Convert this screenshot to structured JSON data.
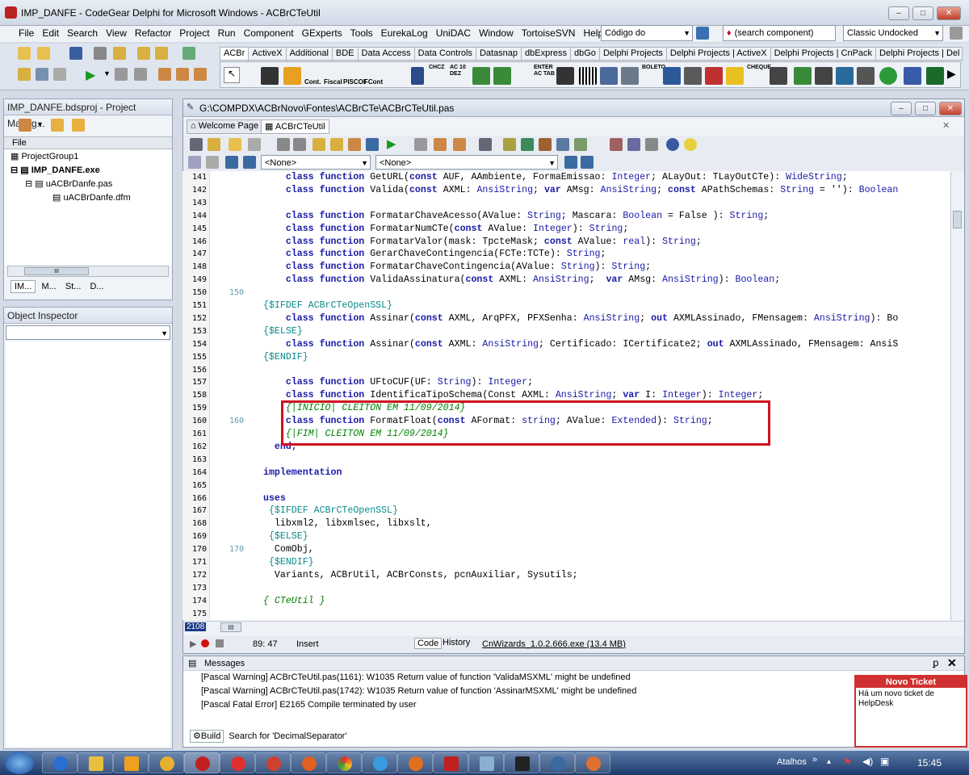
{
  "window": {
    "title": "IMP_DANFE - CodeGear Delphi for Microsoft Windows - ACBrCTeUtil",
    "min": "–",
    "max": "□",
    "close": "✕"
  },
  "menu": [
    "File",
    "Edit",
    "Search",
    "View",
    "Refactor",
    "Project",
    "Run",
    "Component",
    "GExperts",
    "Tools",
    "EurekaLog",
    "UniDAC",
    "Window",
    "TortoiseSVN",
    "Help"
  ],
  "toolbar": {
    "code_combo": "Código do",
    "search_component": "(search component)",
    "layout": "Classic Undocked"
  },
  "palette_tabs": [
    "ACBr",
    "ActiveX",
    "Additional",
    "BDE",
    "Data Access",
    "Data Controls",
    "Datasnap",
    "dbExpress",
    "dbGo",
    "Delphi Projects",
    "Delphi Projects | ActiveX",
    "Delphi Projects | CnPack",
    "Delphi Projects | Del"
  ],
  "palette_labels": [
    "Cont.",
    "Fiscal",
    "PISCOF",
    "FCont",
    "CHCZ",
    "AC 10 DEZ",
    "ENTER AC TAB",
    "BOLETO",
    "CHEQUE"
  ],
  "project_manager": {
    "title": "IMP_DANFE.bdsproj - Project Manag...",
    "file_label": "File",
    "items": [
      "ProjectGroup1",
      "IMP_DANFE.exe",
      "uACBrDanfe.pas",
      "uACBrDanfe.dfm"
    ],
    "tabs": [
      "IM...",
      "M...",
      "St...",
      "D..."
    ],
    "scroll_thumb": "III"
  },
  "object_inspector": {
    "title": "Object Inspector"
  },
  "editor": {
    "path": "G:\\COMPDX\\ACBrNovo\\Fontes\\ACBrCTe\\ACBrCTeUtil.pas",
    "tabs": [
      "Welcome Page",
      "ACBrCTeUtil"
    ],
    "combo1": "<None>",
    "combo2": "<None>",
    "status": {
      "pos": "89: 47",
      "mode": "Insert",
      "tab_code": "Code",
      "tab_history": "History",
      "wizard": "CnWizards_1.0.2.666.exe (13.4 MB)"
    },
    "hscroll": "2108",
    "hscroll_thumb": "III",
    "gutter_marks": {
      "150": "150",
      "160": "160",
      "170": "170"
    },
    "lines": [
      {
        "n": "141",
        "text": "    class function GetURL(const AUF, AAmbiente, FormaEmissao: Integer; ALayOut: TLayOutCTe): WideString;"
      },
      {
        "n": "142",
        "text": "    class function Valida(const AXML: AnsiString; var AMsg: AnsiString; const APathSchemas: String = ''): Boolean"
      },
      {
        "n": "143",
        "text": ""
      },
      {
        "n": "144",
        "text": "    class function FormatarChaveAcesso(AValue: String; Mascara: Boolean = False ): String;"
      },
      {
        "n": "145",
        "text": "    class function FormatarNumCTe(const AValue: Integer): String;"
      },
      {
        "n": "146",
        "text": "    class function FormatarValor(mask: TpcteMask; const AValue: real): String;"
      },
      {
        "n": "147",
        "text": "    class function GerarChaveContingencia(FCTe:TCTe): String;"
      },
      {
        "n": "148",
        "text": "    class function FormatarChaveContingencia(AValue: String): String;"
      },
      {
        "n": "149",
        "text": "    class function ValidaAssinatura(const AXML: AnsiString;  var AMsg: AnsiString): Boolean;"
      },
      {
        "n": "150",
        "text": ""
      },
      {
        "n": "151",
        "text": "{$IFDEF ACBrCTeOpenSSL}"
      },
      {
        "n": "152",
        "text": "    class function Assinar(const AXML, ArqPFX, PFXSenha: AnsiString; out AXMLAssinado, FMensagem: AnsiString): Bo"
      },
      {
        "n": "153",
        "text": "{$ELSE}"
      },
      {
        "n": "154",
        "text": "    class function Assinar(const AXML: AnsiString; Certificado: ICertificate2; out AXMLAssinado, FMensagem: AnsiS"
      },
      {
        "n": "155",
        "text": "{$ENDIF}"
      },
      {
        "n": "156",
        "text": ""
      },
      {
        "n": "157",
        "text": "    class function UFtoCUF(UF: String): Integer;"
      },
      {
        "n": "158",
        "text": "    class function IdentificaTipoSchema(Const AXML: AnsiString; var I: Integer): Integer;"
      },
      {
        "n": "159",
        "text": "    {|INICIO| CLEITON EM 11/09/2014}"
      },
      {
        "n": "160",
        "text": "    class function FormatFloat(const AFormat: string; AValue: Extended): String;"
      },
      {
        "n": "161",
        "text": "    {|FIM| CLEITON EM 11/09/2014}"
      },
      {
        "n": "162",
        "text": "  end;"
      },
      {
        "n": "163",
        "text": ""
      },
      {
        "n": "164",
        "text": "implementation"
      },
      {
        "n": "165",
        "text": ""
      },
      {
        "n": "166",
        "text": "uses"
      },
      {
        "n": "167",
        "text": " {$IFDEF ACBrCTeOpenSSL}"
      },
      {
        "n": "168",
        "text": "  libxml2, libxmlsec, libxslt,"
      },
      {
        "n": "169",
        "text": " {$ELSE}"
      },
      {
        "n": "170",
        "text": "  ComObj,"
      },
      {
        "n": "171",
        "text": " {$ENDIF}"
      },
      {
        "n": "172",
        "text": "  Variants, ACBrUtil, ACBrConsts, pcnAuxiliar, Sysutils;"
      },
      {
        "n": "173",
        "text": ""
      },
      {
        "n": "174",
        "text": "{ CTeUtil }"
      },
      {
        "n": "175",
        "text": ""
      }
    ]
  },
  "messages": {
    "title": "Messages",
    "items": [
      "[Pascal Warning] ACBrCTeUtil.pas(1161): W1035 Return value of function 'ValidaMSXML' might be undefined",
      "[Pascal Warning] ACBrCTeUtil.pas(1742): W1035 Return value of function 'AssinarMSXML' might be undefined",
      "[Pascal Fatal Error] E2165 Compile terminated by user"
    ],
    "tabs": [
      "Build",
      "Search for 'DecimalSeparator'"
    ],
    "pin": "ꝑ",
    "close": "✕"
  },
  "ticket": {
    "title": "Novo Ticket",
    "body": "Há um novo ticket de HelpDesk"
  },
  "taskbar": {
    "atalhos": "Atalhos",
    "time": "15:45"
  },
  "colors": {
    "highlight": "#d01020",
    "keyword": "#1a1aa6",
    "comment": "#008000"
  }
}
